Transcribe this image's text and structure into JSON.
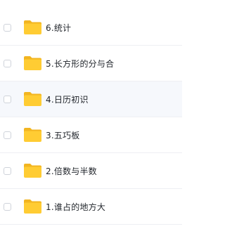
{
  "files": [
    {
      "name": "6.统计",
      "icon": "folder-icon",
      "highlighted": false
    },
    {
      "name": "5.长方形的分与合",
      "icon": "folder-icon",
      "highlighted": false
    },
    {
      "name": "4.日历初识",
      "icon": "folder-icon",
      "highlighted": true
    },
    {
      "name": "3.五巧板",
      "icon": "folder-icon",
      "highlighted": false
    },
    {
      "name": "2.倍数与半数",
      "icon": "folder-icon",
      "highlighted": false
    },
    {
      "name": "1.谁占的地方大",
      "icon": "folder-icon",
      "highlighted": false
    }
  ],
  "colors": {
    "folder_body": "#ffcc33",
    "folder_tab": "#f2b521",
    "highlight_row": "#f6f8fc"
  }
}
